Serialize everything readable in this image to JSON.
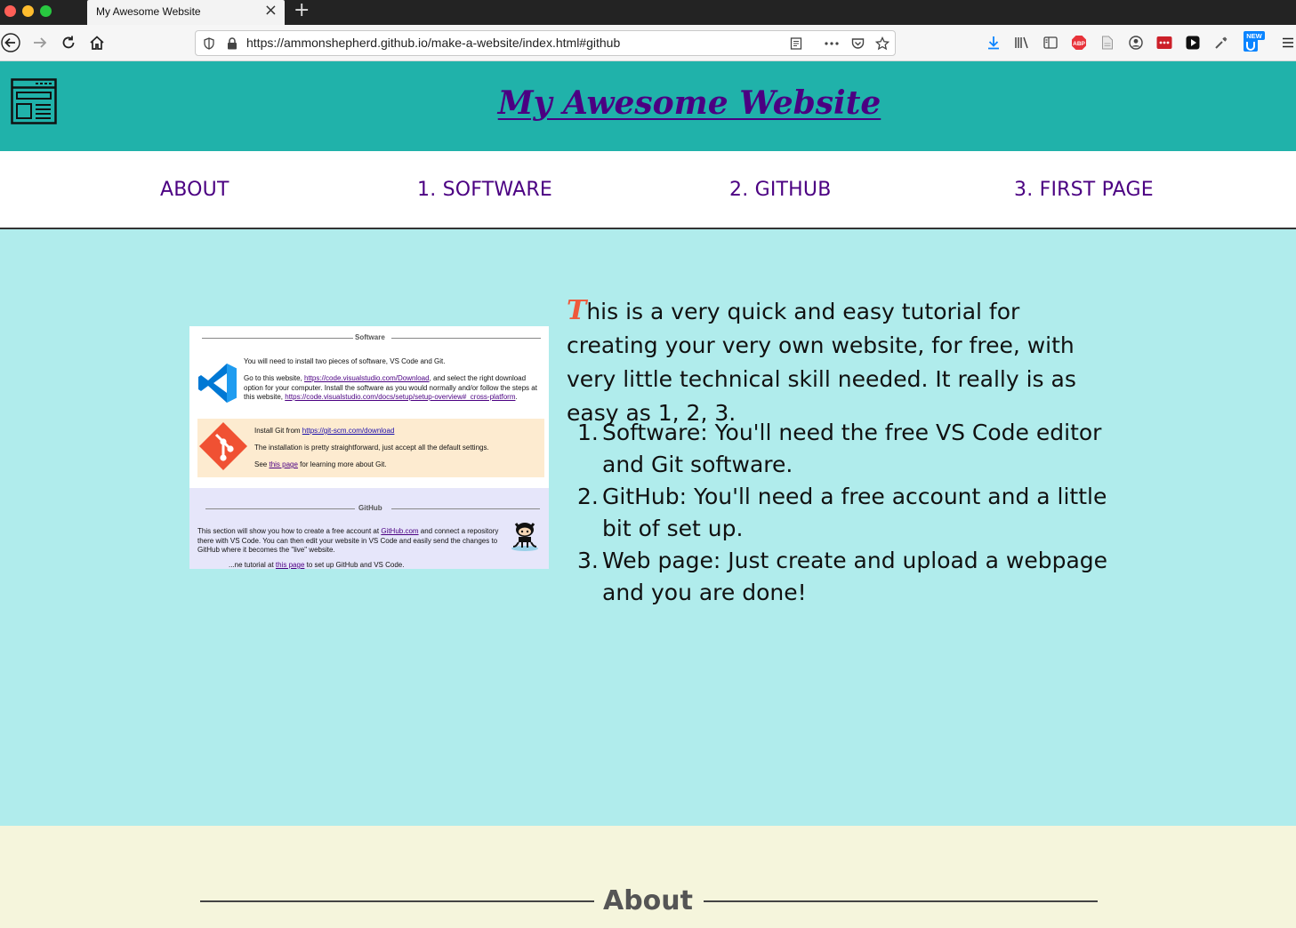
{
  "browser": {
    "tab_title": "My Awesome Website",
    "url": "https://ammonshepherd.github.io/make-a-website/index.html#github",
    "new_badge": "NEW",
    "abp_label": "ABP"
  },
  "site": {
    "title": "My Awesome Website",
    "nav": [
      "ABOUT",
      "1. SOFTWARE",
      "2. GITHUB",
      "3. FIRST PAGE"
    ]
  },
  "intro": {
    "dropcap": "T",
    "text": "his is a very quick and easy tutorial for creating your very own website, for free, with very little technical skill needed. It really is as easy as 1, 2, 3."
  },
  "steps": [
    {
      "num": "1.",
      "text": "Software: You'll need the free VS Code editor and Git software."
    },
    {
      "num": "2.",
      "text": "GitHub: You'll need a free account and a little bit of set up."
    },
    {
      "num": "3.",
      "text": "Web page: Just create and upload a webpage and you are done!"
    }
  ],
  "preview": {
    "software_heading": "Software",
    "p1": "You will need to install two pieces of software, VS Code and Git.",
    "p2_a": "Go to this website, ",
    "p2_link1": "https://code.visualstudio.com/Download",
    "p2_b": ", and select the right download option for your computer. Install the software as you would normally and/or follow the steps at this website, ",
    "p2_link2": "https://code.visualstudio.com/docs/setup/setup-overview#_cross-platform",
    "p2_c": ".",
    "git_a": "Install Git from ",
    "git_link": "https://git-scm.com/download",
    "git_p2": "The installation is pretty straightforward, just accept all the default settings.",
    "git_p3_a": "See ",
    "git_p3_link": "this page",
    "git_p3_b": " for learning more about Git.",
    "github_heading": "GitHub",
    "gh_a": "This section will show you how to create a free account at ",
    "gh_link": "GitHub.com",
    "gh_b": " and connect a repository there with VS Code. You can then edit your website in VS Code and easily send the changes to GitHub where it becomes the \"live\" website.",
    "gh_p2_a": "...ne tutorial at ",
    "gh_p2_link": "this page",
    "gh_p2_b": " to set up GitHub and VS Code."
  },
  "about": {
    "title": "About"
  },
  "colors": {
    "header_bg": "#20b2aa",
    "title_color": "#4b0082",
    "main_bg": "#b0ecec",
    "about_bg": "#f5f5dc",
    "dropcap": "#ef5a3c"
  }
}
